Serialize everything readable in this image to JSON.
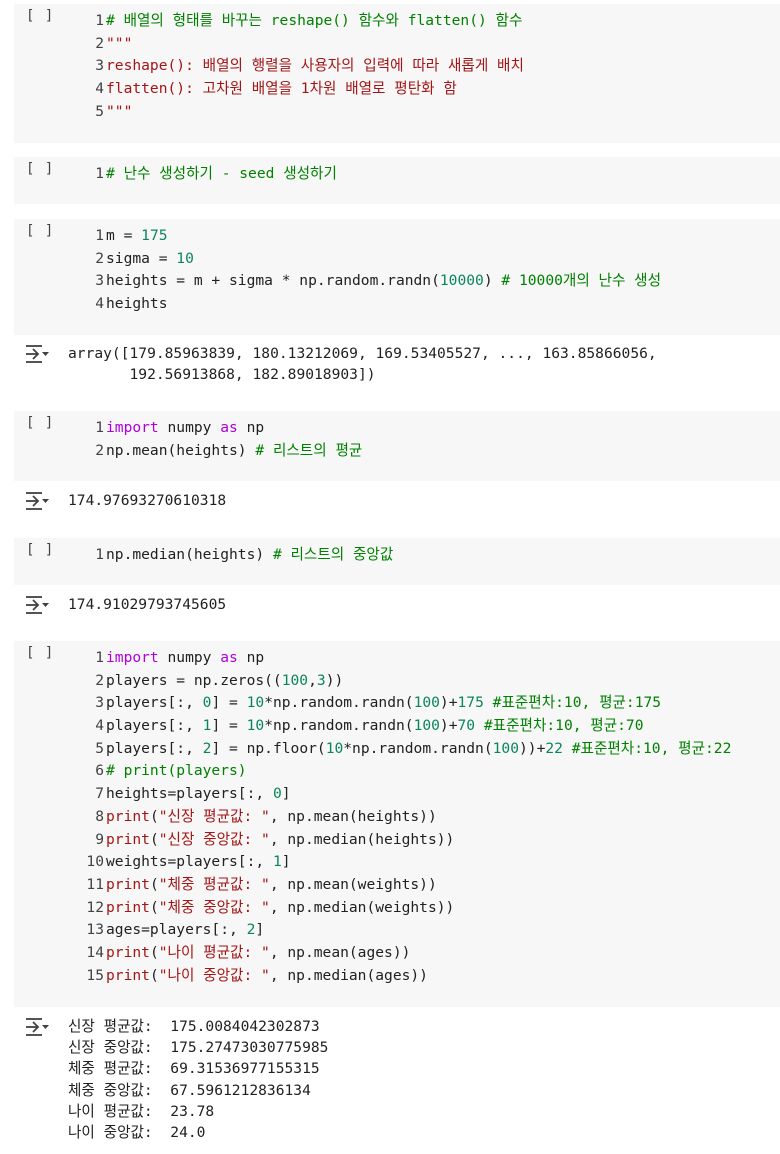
{
  "run_label": "[ ]",
  "cells": [
    {
      "lines": [
        [
          {
            "t": "# 배열의 형태를 바꾸는 reshape() 함수와 flatten() 함수",
            "c": "cm"
          }
        ],
        [
          {
            "t": "\"\"\"",
            "c": "str"
          }
        ],
        [
          {
            "t": "reshape(): 배열의 행렬을 사용자의 입력에 따라 새롭게 배치",
            "c": "str"
          }
        ],
        [
          {
            "t": "flatten(): 고차원 배열을 1차원 배열로 평탄화 함",
            "c": "str"
          }
        ],
        [
          {
            "t": "\"\"\"",
            "c": "str"
          }
        ]
      ]
    },
    {
      "lines": [
        [
          {
            "t": "# 난수 생성하기 - seed 생성하기",
            "c": "cm"
          }
        ]
      ]
    },
    {
      "lines": [
        [
          {
            "t": "m = "
          },
          {
            "t": "175",
            "c": "num"
          }
        ],
        [
          {
            "t": "sigma = "
          },
          {
            "t": "10",
            "c": "num"
          }
        ],
        [
          {
            "t": "heights = m + sigma * np.random.randn("
          },
          {
            "t": "10000",
            "c": "num"
          },
          {
            "t": ") "
          },
          {
            "t": "# 10000개의 난수 생성",
            "c": "cm"
          }
        ],
        [
          {
            "t": "heights"
          }
        ]
      ],
      "output": [
        "array([179.85963839, 180.13212069, 169.53405527, ..., 163.85866056,",
        "       192.56913868, 182.89018903])"
      ]
    },
    {
      "lines": [
        [
          {
            "t": "import",
            "c": "kw"
          },
          {
            "t": " numpy "
          },
          {
            "t": "as",
            "c": "kw"
          },
          {
            "t": " np"
          }
        ],
        [
          {
            "t": "np.mean(heights) "
          },
          {
            "t": "# 리스트의 평균",
            "c": "cm"
          }
        ]
      ],
      "output": [
        "174.97693270610318"
      ]
    },
    {
      "lines": [
        [
          {
            "t": "np.median(heights) "
          },
          {
            "t": "# 리스트의 중앙값",
            "c": "cm"
          }
        ]
      ],
      "output": [
        "174.91029793745605"
      ]
    },
    {
      "lines": [
        [
          {
            "t": "import",
            "c": "kw"
          },
          {
            "t": " numpy "
          },
          {
            "t": "as",
            "c": "kw"
          },
          {
            "t": " np"
          }
        ],
        [
          {
            "t": "players = np.zeros(("
          },
          {
            "t": "100",
            "c": "num"
          },
          {
            "t": ","
          },
          {
            "t": "3",
            "c": "num"
          },
          {
            "t": "))"
          }
        ],
        [
          {
            "t": "players[:, "
          },
          {
            "t": "0",
            "c": "num"
          },
          {
            "t": "] = "
          },
          {
            "t": "10",
            "c": "num"
          },
          {
            "t": "*np.random.randn("
          },
          {
            "t": "100",
            "c": "num"
          },
          {
            "t": ")+"
          },
          {
            "t": "175",
            "c": "num"
          },
          {
            "t": " "
          },
          {
            "t": "#표준편차:10, 평균:175",
            "c": "cm"
          }
        ],
        [
          {
            "t": "players[:, "
          },
          {
            "t": "1",
            "c": "num"
          },
          {
            "t": "] = "
          },
          {
            "t": "10",
            "c": "num"
          },
          {
            "t": "*np.random.randn("
          },
          {
            "t": "100",
            "c": "num"
          },
          {
            "t": ")+"
          },
          {
            "t": "70",
            "c": "num"
          },
          {
            "t": " "
          },
          {
            "t": "#표준편차:10, 평균:70",
            "c": "cm"
          }
        ],
        [
          {
            "t": "players[:, "
          },
          {
            "t": "2",
            "c": "num"
          },
          {
            "t": "] = np.floor("
          },
          {
            "t": "10",
            "c": "num"
          },
          {
            "t": "*np.random.randn("
          },
          {
            "t": "100",
            "c": "num"
          },
          {
            "t": "))+"
          },
          {
            "t": "22",
            "c": "num"
          },
          {
            "t": " "
          },
          {
            "t": "#표준편차:10, 평균:22",
            "c": "cm"
          }
        ],
        [
          {
            "t": "# print(players)",
            "c": "cm"
          }
        ],
        [
          {
            "t": "heights=players[:, "
          },
          {
            "t": "0",
            "c": "num"
          },
          {
            "t": "]"
          }
        ],
        [
          {
            "t": "print",
            "c": "str"
          },
          {
            "t": "("
          },
          {
            "t": "\"신장 평균값: \"",
            "c": "str"
          },
          {
            "t": ", np.mean(heights))"
          }
        ],
        [
          {
            "t": "print",
            "c": "str"
          },
          {
            "t": "("
          },
          {
            "t": "\"신장 중앙값: \"",
            "c": "str"
          },
          {
            "t": ", np.median(heights))"
          }
        ],
        [
          {
            "t": "weights=players[:, "
          },
          {
            "t": "1",
            "c": "num"
          },
          {
            "t": "]"
          }
        ],
        [
          {
            "t": "print",
            "c": "str"
          },
          {
            "t": "("
          },
          {
            "t": "\"체중 평균값: \"",
            "c": "str"
          },
          {
            "t": ", np.mean(weights))"
          }
        ],
        [
          {
            "t": "print",
            "c": "str"
          },
          {
            "t": "("
          },
          {
            "t": "\"체중 중앙값: \"",
            "c": "str"
          },
          {
            "t": ", np.median(weights))"
          }
        ],
        [
          {
            "t": "ages=players[:, "
          },
          {
            "t": "2",
            "c": "num"
          },
          {
            "t": "]"
          }
        ],
        [
          {
            "t": "print",
            "c": "str"
          },
          {
            "t": "("
          },
          {
            "t": "\"나이 평균값: \"",
            "c": "str"
          },
          {
            "t": ", np.mean(ages))"
          }
        ],
        [
          {
            "t": "print",
            "c": "str"
          },
          {
            "t": "("
          },
          {
            "t": "\"나이 중앙값: \"",
            "c": "str"
          },
          {
            "t": ", np.median(ages))"
          }
        ]
      ],
      "output": [
        "신장 평균값:  175.0084042302873",
        "신장 중앙값:  175.27473030775985",
        "체중 평균값:  69.31536977155315",
        "체중 중앙값:  67.5961212836134",
        "나이 평균값:  23.78",
        "나이 중앙값:  24.0"
      ]
    }
  ]
}
